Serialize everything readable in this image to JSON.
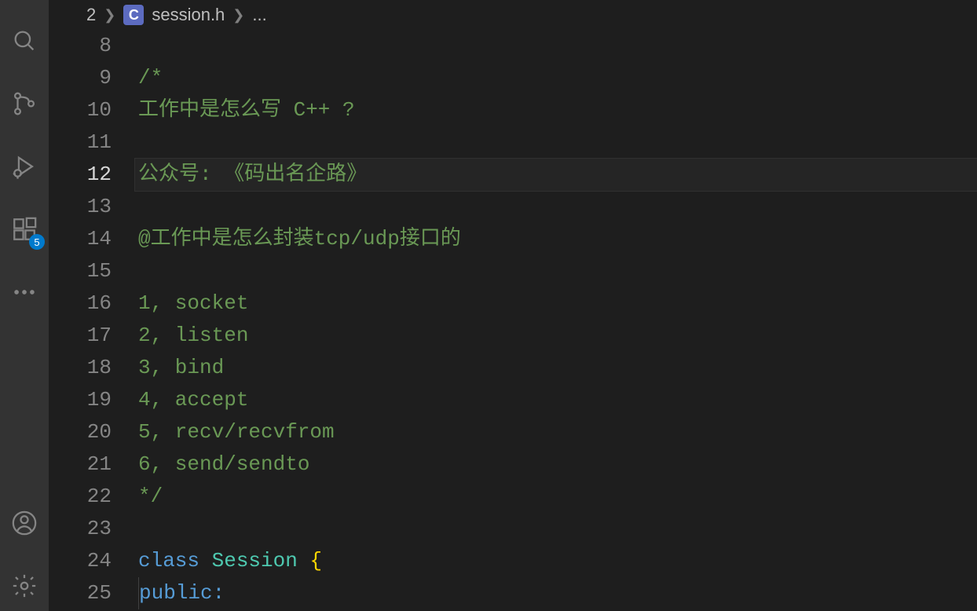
{
  "activityBar": {
    "badgeCount": "5"
  },
  "breadcrumb": {
    "prefix": "2",
    "langBadge": "C",
    "filename": "session.h",
    "rest": "..."
  },
  "editor": {
    "activeLine": 12,
    "lines": [
      {
        "num": 8,
        "type": "blank",
        "text": ""
      },
      {
        "num": 9,
        "type": "comment",
        "text": "/*"
      },
      {
        "num": 10,
        "type": "comment",
        "text": "工作中是怎么写 C++ ?"
      },
      {
        "num": 11,
        "type": "blank",
        "text": ""
      },
      {
        "num": 12,
        "type": "comment",
        "text": "公众号: 《码出名企路》"
      },
      {
        "num": 13,
        "type": "blank",
        "text": ""
      },
      {
        "num": 14,
        "type": "comment",
        "text": "@工作中是怎么封装tcp/udp接口的"
      },
      {
        "num": 15,
        "type": "blank",
        "text": ""
      },
      {
        "num": 16,
        "type": "comment",
        "text": "1, socket"
      },
      {
        "num": 17,
        "type": "comment",
        "text": "2, listen"
      },
      {
        "num": 18,
        "type": "comment",
        "text": "3, bind"
      },
      {
        "num": 19,
        "type": "comment",
        "text": "4, accept"
      },
      {
        "num": 20,
        "type": "comment",
        "text": "5, recv/recvfrom"
      },
      {
        "num": 21,
        "type": "comment",
        "text": "6, send/sendto"
      },
      {
        "num": 22,
        "type": "comment",
        "text": "*/"
      },
      {
        "num": 23,
        "type": "blank",
        "text": ""
      },
      {
        "num": 24,
        "type": "classdecl",
        "cls": "class",
        "name": "Session",
        "brace": "{"
      },
      {
        "num": 25,
        "type": "access",
        "text": "public:"
      }
    ]
  }
}
